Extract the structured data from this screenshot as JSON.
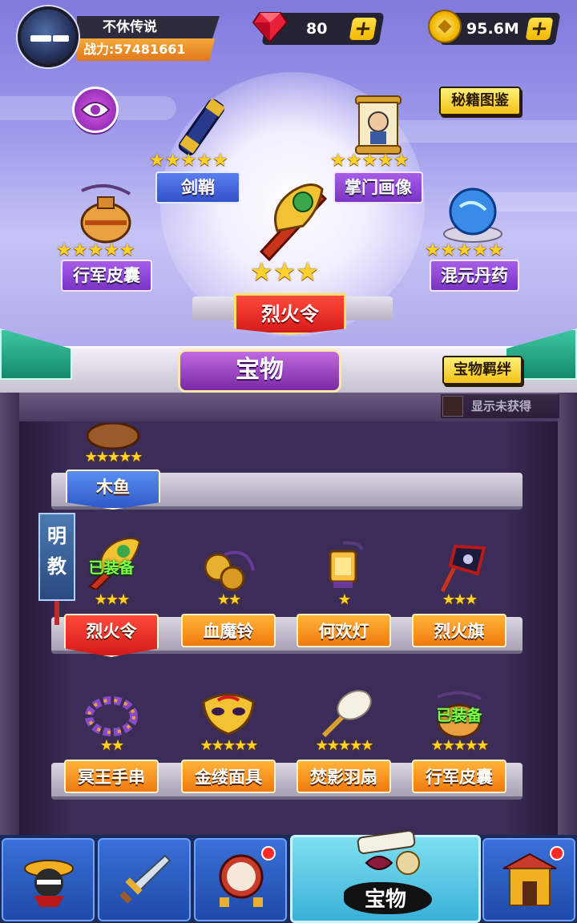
{
  "player": {
    "name": "不休传说",
    "power_label": "战力:",
    "power_value": "57481661"
  },
  "resources": {
    "gems": "80",
    "gold": "95.6M",
    "plus": "+"
  },
  "buttons": {
    "codex": "秘籍图鉴",
    "bond": "宝物羁绊",
    "show_unowned": "显示未获得"
  },
  "panel_title": "宝物",
  "display": {
    "center": {
      "name": "烈火令",
      "stars": 3
    },
    "slots": [
      {
        "name": "剑鞘",
        "stars": 5
      },
      {
        "name": "掌门画像",
        "stars": 5
      },
      {
        "name": "行军皮囊",
        "stars": 5
      },
      {
        "name": "混元丹药",
        "stars": 5
      }
    ]
  },
  "sect_label": "明教",
  "shelf": {
    "row0": [
      {
        "name": "木鱼",
        "stars": 5
      }
    ],
    "row1": [
      {
        "name": "烈火令",
        "stars": 3,
        "equipped": "已装备"
      },
      {
        "name": "血魔铃",
        "stars": 2
      },
      {
        "name": "何欢灯",
        "stars": 1
      },
      {
        "name": "烈火旗",
        "stars": 3
      }
    ],
    "row2": [
      {
        "name": "冥王手串",
        "stars": 2
      },
      {
        "name": "金缕面具",
        "stars": 5
      },
      {
        "name": "焚影羽扇",
        "stars": 5
      },
      {
        "name": "行军皮囊",
        "stars": 5,
        "equipped": "已装备"
      }
    ]
  },
  "nav": {
    "tabs": [
      {
        "icon": "hero-icon",
        "badge": false
      },
      {
        "icon": "sword-icon",
        "badge": false
      },
      {
        "icon": "drum-icon",
        "badge": true
      },
      {
        "icon": "treasure-icon",
        "label": "宝物",
        "active": true
      },
      {
        "icon": "gate-icon",
        "badge": true
      }
    ]
  },
  "colors": {
    "accent_gold": "#f2c218",
    "treasure_purple": "#9a3ec4",
    "equipped_green": "#7eff4a",
    "badge_red": "#ff2a2a"
  }
}
